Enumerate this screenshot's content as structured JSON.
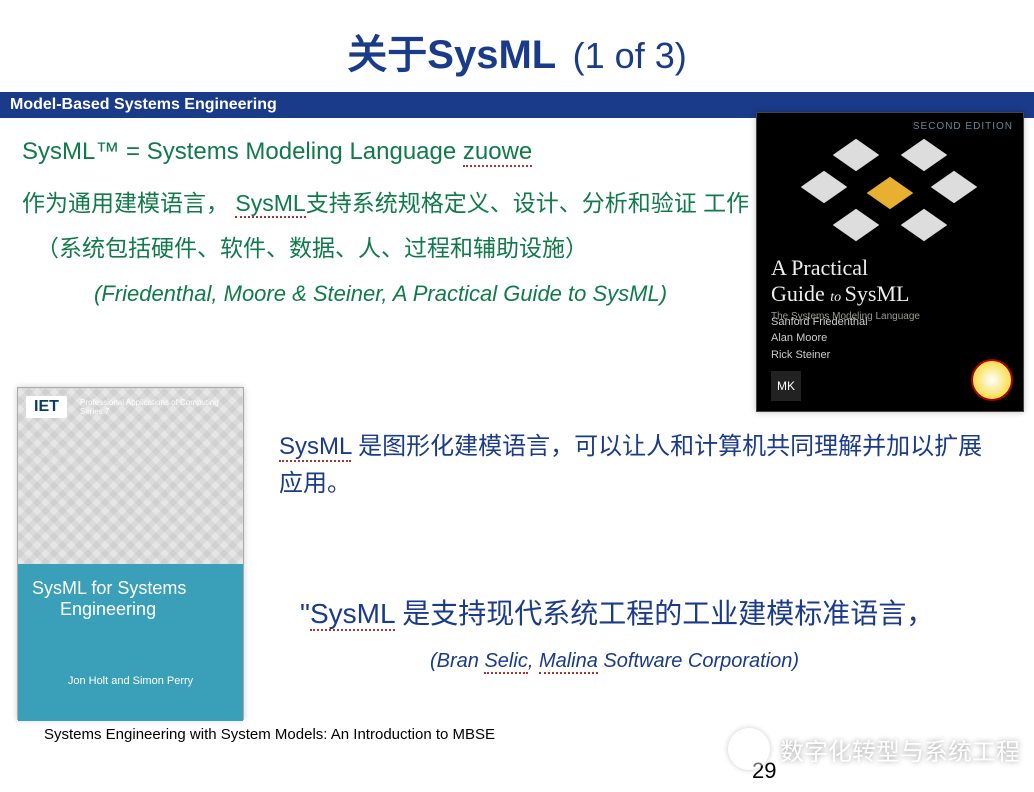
{
  "title": {
    "main": "关于SysML",
    "count": "(1 of 3)"
  },
  "bar": "Model-Based Systems Engineering",
  "intro": {
    "line1_prefix": "SysML™ = Systems Modeling Language ",
    "line1_dotted": "zuowe",
    "line2_prefix": "作为通用建模语言， ",
    "line2_dotted": "SysML",
    "line2_suffix": "支持系统规格定义、设计、分析和验证 工作",
    "line3": "（系统包括硬件、软件、数据、人、过程和辅助设施）",
    "citation": "(Friedenthal, Moore & Steiner, A Practical Guide to SysML)"
  },
  "book1": {
    "edition": "SECOND EDITION",
    "title_l1": "A Practical",
    "title_l2_a": "Guide ",
    "title_l2_to": "to ",
    "title_l2_b": "SysML",
    "subtitle": "The Systems Modeling Language",
    "authors": [
      "Sanford Friedenthal",
      "Alan Moore",
      "Rick Steiner"
    ],
    "publisher": "MK"
  },
  "book2": {
    "iet": "IET",
    "series": "Professional Applications of Computing Series 7",
    "title_l1": "SysML for Systems",
    "title_l2": "Engineering",
    "authors": "Jon Holt and Simon Perry"
  },
  "mid_para": {
    "dotted": "SysML",
    "rest": " 是图形化建模语言，可以让人和计算机共同理解并加以扩展应用。"
  },
  "quote": {
    "open": "\"",
    "dotted": "SysML",
    "rest": " 是支持现代系统工程的工业建模标准语言，",
    "cite_prefix": "(Bran ",
    "cite_dotted": "Selic",
    "cite_suffix": ", ",
    "cite_dotted2": "Malina",
    "cite_end": " Software Corporation)"
  },
  "caption": "Systems Engineering with System Models: An Introduction to MBSE",
  "page_number": "29",
  "watermark": "数字化转型与系统工程"
}
